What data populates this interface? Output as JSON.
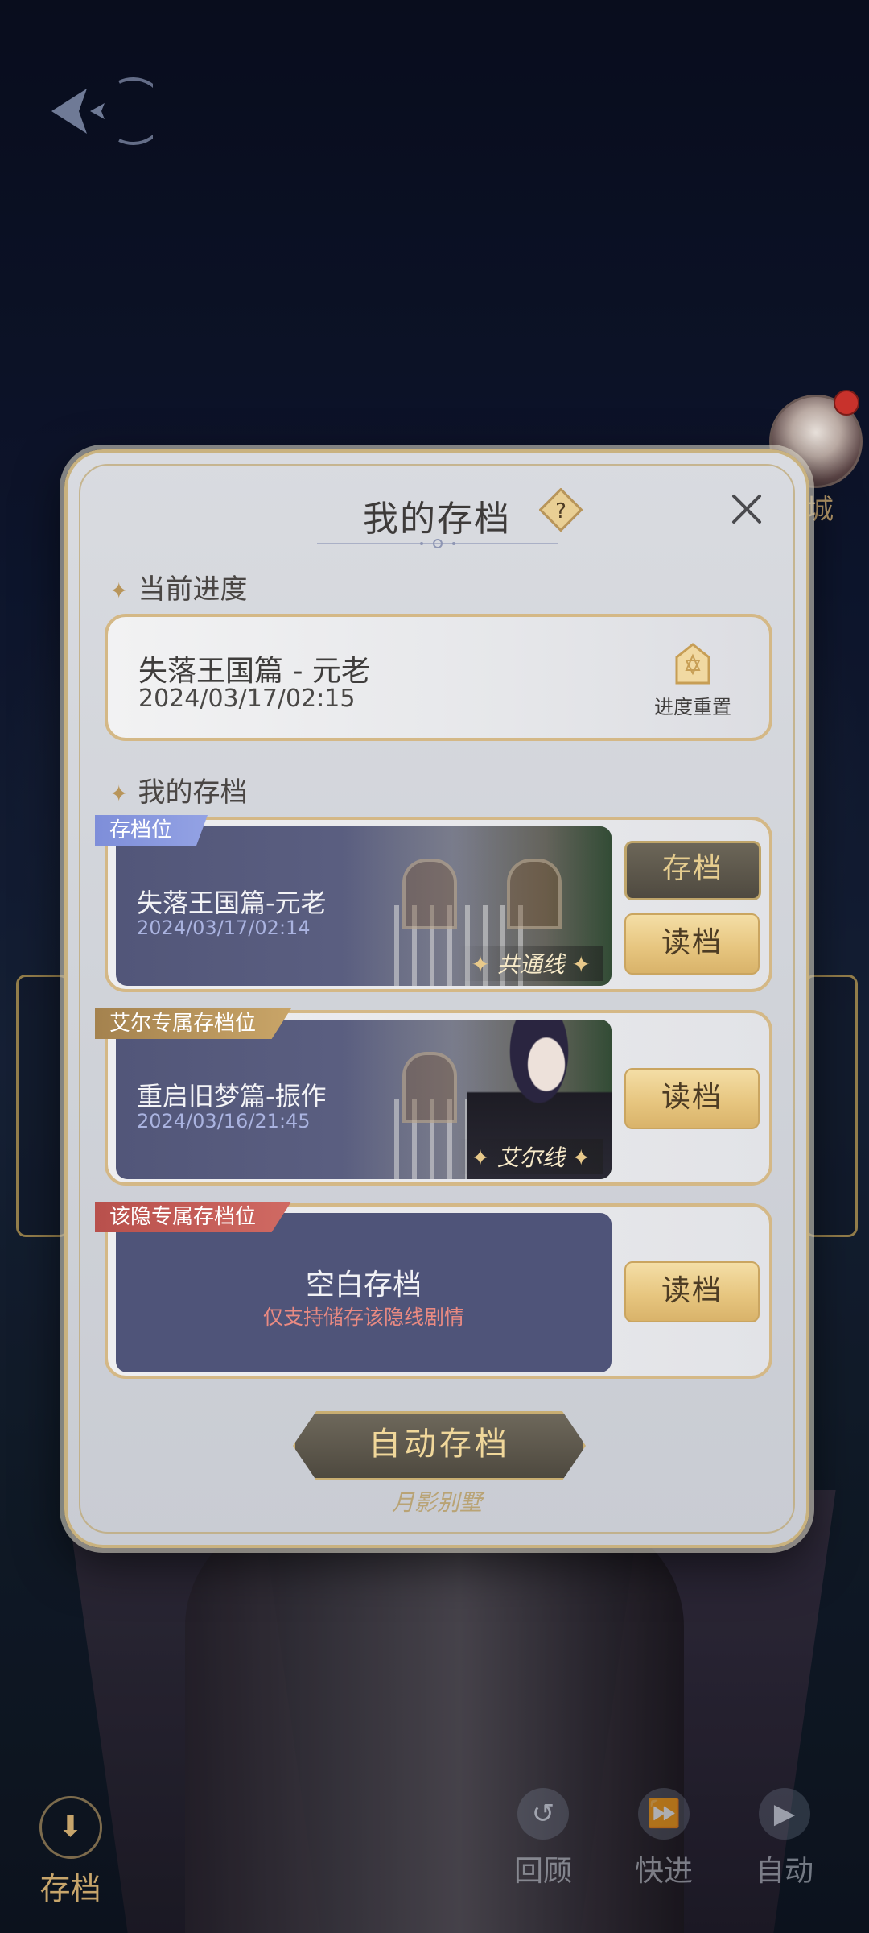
{
  "background": {
    "bottom_controls": {
      "save": "存档",
      "review": "回顾",
      "fast_forward": "快进",
      "auto": "自动"
    },
    "shop_label": "城"
  },
  "dialog": {
    "title": "我的存档",
    "current_section": {
      "label": "当前进度",
      "chapter": "失落王国篇 - 元老",
      "time": "2024/03/17/02:15",
      "reset_label": "进度重置"
    },
    "saves_section": {
      "label": "我的存档",
      "slots": [
        {
          "tag": "存档位",
          "name": "失落王国篇-元老",
          "time": "2024/03/17/02:14",
          "route": "共通线",
          "save_button": "存档",
          "load_button": "读档"
        },
        {
          "tag": "艾尔专属存档位",
          "name": "重启旧梦篇-振作",
          "time": "2024/03/16/21:45",
          "route": "艾尔线",
          "load_button": "读档"
        },
        {
          "tag": "该隐专属存档位",
          "empty_title": "空白存档",
          "empty_note": "仅支持储存该隐线剧情",
          "load_button": "读档"
        }
      ]
    },
    "auto_save_button": "自动存档",
    "logo_text": "月影别墅"
  },
  "colors": {
    "accent_gold": "#d4b886",
    "slot_blue": "#525679",
    "warning_red": "#e98a82"
  },
  "icons": {
    "back": "back-arrow-icon",
    "help": "help-diamond-icon",
    "close": "close-icon",
    "reset": "reset-emblem-icon"
  }
}
